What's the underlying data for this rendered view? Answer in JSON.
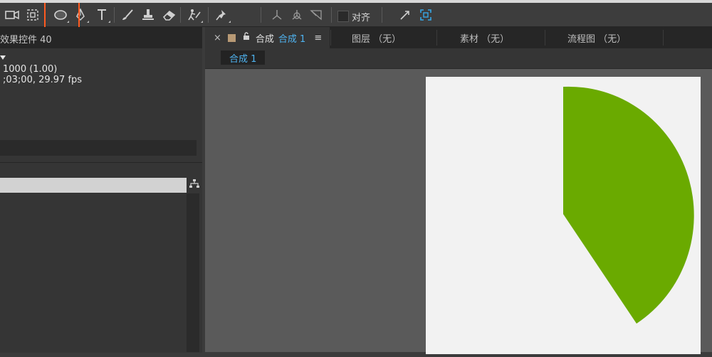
{
  "toolbar": {
    "tools": [
      {
        "icon": "camera-icon"
      },
      {
        "icon": "region-of-interest-icon"
      },
      {
        "icon": "ellipse-tool-icon"
      },
      {
        "icon": "pen-tool-icon"
      },
      {
        "icon": "type-tool-icon"
      },
      {
        "icon": "brush-tool-icon"
      },
      {
        "icon": "clone-stamp-icon"
      },
      {
        "icon": "eraser-tool-icon"
      },
      {
        "icon": "roto-brush-icon"
      },
      {
        "icon": "puppet-pin-icon"
      },
      {
        "icon": "local-axis-icon"
      },
      {
        "icon": "world-axis-icon"
      },
      {
        "icon": "view-axis-icon"
      }
    ],
    "align_label": "对齐",
    "snap_icon": "snapping-icon",
    "target_icon": "snap-target-icon",
    "highlight_color": "#ff5a1f"
  },
  "left_panel": {
    "tab_label": "效果控件 40",
    "info_line1": "1000 (1.00)",
    "info_line2": ";03;00, 29.97 fps",
    "flowchart_icon": "flowchart-icon"
  },
  "right_panel": {
    "tabs": [
      {
        "close": "×",
        "name": "合成",
        "comp": "合成 1",
        "menu": "≡"
      },
      {
        "label": "图层 （无）"
      },
      {
        "label": "素材 （无）"
      },
      {
        "label": "流程图 （无）"
      }
    ],
    "comp_tab_label": "合成 1",
    "composition": {
      "background": "#f2f2f2",
      "shape_color": "#6aaa00"
    }
  }
}
